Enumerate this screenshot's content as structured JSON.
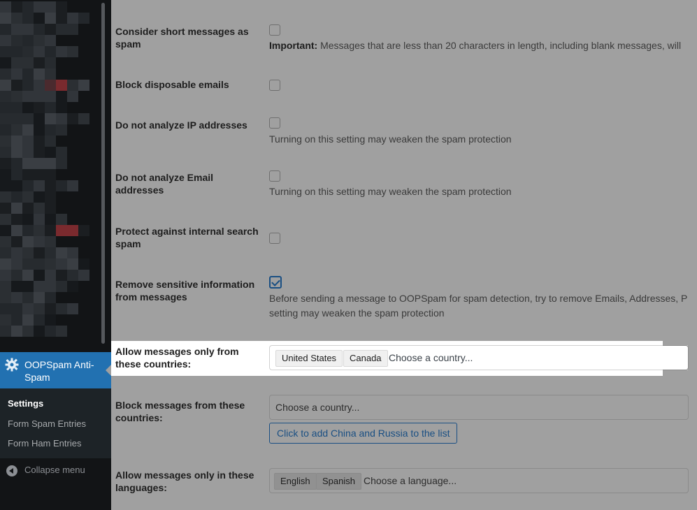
{
  "sidebar": {
    "active_item": {
      "label": "OOPSpam Anti-Spam",
      "icon": "gear-icon"
    },
    "submenu": [
      {
        "label": "Settings",
        "current": true
      },
      {
        "label": "Form Spam Entries",
        "current": false
      },
      {
        "label": "Form Ham Entries",
        "current": false
      }
    ],
    "collapse_label": "Collapse menu",
    "colors": {
      "bg": "#121416",
      "active": "#2271b1",
      "submenu_bg": "#1d2327"
    }
  },
  "settings": {
    "short_messages": {
      "label": "Consider short messages as spam",
      "checked": false,
      "note_strong": "Important:",
      "note": "Messages that are less than 20 characters in length, including blank messages, will"
    },
    "block_disposable": {
      "label": "Block disposable emails",
      "checked": false
    },
    "no_ip": {
      "label": "Do not analyze IP addresses",
      "checked": false,
      "note": "Turning on this setting may weaken the spam protection"
    },
    "no_email": {
      "label": "Do not analyze Email addresses",
      "checked": false,
      "note": "Turning on this setting may weaken the spam protection"
    },
    "internal_search": {
      "label": "Protect against internal search spam",
      "checked": false
    },
    "remove_sensitive": {
      "label": "Remove sensitive information from messages",
      "checked": true,
      "note_line1": "Before sending a message to OOPSpam for spam detection, try to remove Emails, Addresses, P",
      "note_line2": "setting may weaken the spam protection"
    },
    "allow_countries": {
      "label": "Allow messages only from these countries:",
      "tags": [
        "United States",
        "Canada"
      ],
      "placeholder": "Choose a country..."
    },
    "block_countries": {
      "label": "Block messages from these countries:",
      "placeholder": "Choose a country...",
      "button": "Click to add China and Russia to the list"
    },
    "allow_languages": {
      "label": "Allow messages only in these languages:",
      "tags": [
        "English",
        "Spanish"
      ],
      "placeholder": "Choose a language..."
    }
  }
}
